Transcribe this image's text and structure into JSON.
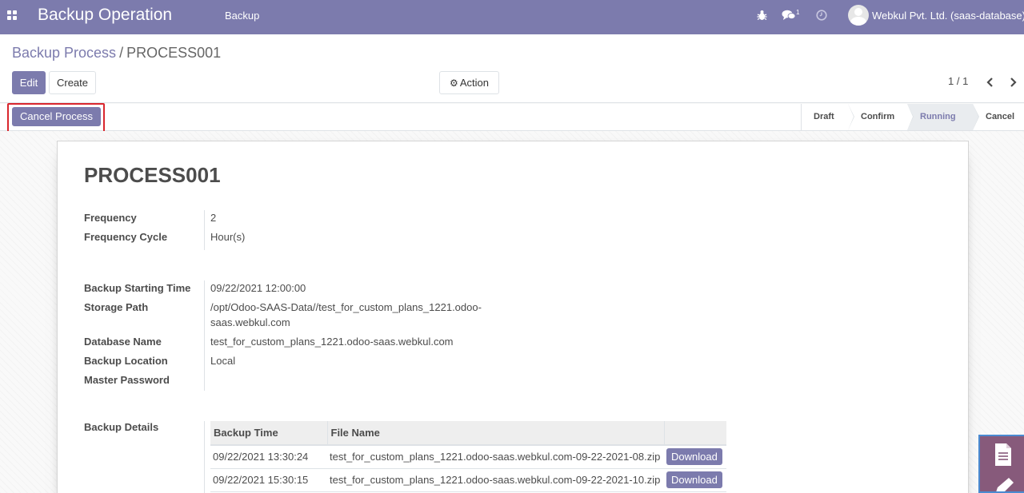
{
  "navbar": {
    "app_title": "Backup Operation",
    "menu_item": "Backup",
    "chat_count": "1",
    "user_name": "Webkul Pvt. Ltd. (saas-database)"
  },
  "breadcrumb": {
    "parent": "Backup Process",
    "separator": "/",
    "current": "PROCESS001"
  },
  "toolbar": {
    "edit_label": "Edit",
    "create_label": "Create",
    "action_label": "Action"
  },
  "pager": {
    "value": "1 / 1"
  },
  "statusbar": {
    "cancel_process_label": "Cancel Process",
    "stages": [
      "Draft",
      "Confirm",
      "Running",
      "Cancel"
    ],
    "active_stage": "Running"
  },
  "record": {
    "title": "PROCESS001",
    "fields": {
      "frequency_label": "Frequency",
      "frequency_value": "2",
      "frequency_cycle_label": "Frequency Cycle",
      "frequency_cycle_value": "Hour(s)",
      "backup_starting_time_label": "Backup Starting Time",
      "backup_starting_time_value": "09/22/2021 12:00:00",
      "storage_path_label": "Storage Path",
      "storage_path_value_line1": "/opt/Odoo-SAAS-Data//test_for_custom_plans_1221.odoo-",
      "storage_path_value_line2": "saas.webkul.com",
      "database_name_label": "Database Name",
      "database_name_value": "test_for_custom_plans_1221.odoo-saas.webkul.com",
      "backup_location_label": "Backup Location",
      "backup_location_value": "Local",
      "master_password_label": "Master Password",
      "backup_details_label": "Backup Details"
    }
  },
  "backup_table": {
    "headers": [
      "Backup Time",
      "File Name",
      ""
    ],
    "rows": [
      {
        "time": "09/22/2021 13:30:24",
        "file": "test_for_custom_plans_1221.odoo-saas.webkul.com-09-22-2021-08.zip",
        "action": "Download"
      },
      {
        "time": "09/22/2021 15:30:15",
        "file": "test_for_custom_plans_1221.odoo-saas.webkul.com-09-22-2021-10.zip",
        "action": "Download"
      }
    ]
  },
  "colors": {
    "brand": "#7c7bad",
    "highlight": "#d9272e",
    "widget": "#875a7b"
  },
  "icons": [
    "apps-icon",
    "bug-icon",
    "chat-icon",
    "clock-icon",
    "avatar",
    "gear-icon",
    "chevron-left-icon",
    "chevron-right-icon",
    "document-icon",
    "pencil-icon"
  ]
}
